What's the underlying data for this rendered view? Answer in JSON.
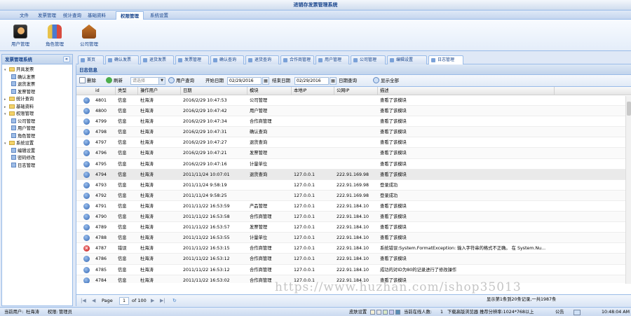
{
  "app": {
    "title": "进销存发票管理系统"
  },
  "menu": [
    "文件",
    "发票管理",
    "统计查询",
    "基础资料",
    "权限管理",
    "系统设置"
  ],
  "menu_active": 4,
  "ribbon": [
    "用户管理",
    "角色管理",
    "公司管理"
  ],
  "left_panel": {
    "title": "发票管理系统",
    "collapse": "«",
    "tree": [
      {
        "label": "开具发票",
        "type": "folder",
        "level": 0,
        "expanded": true
      },
      {
        "label": "确认发票",
        "type": "leaf",
        "level": 1
      },
      {
        "label": "退货发票",
        "type": "leaf",
        "level": 1
      },
      {
        "label": "发票管理",
        "type": "leaf",
        "level": 1
      },
      {
        "label": "统计查询",
        "type": "folder",
        "level": 0,
        "expanded": false
      },
      {
        "label": "基础资料",
        "type": "folder",
        "level": 0,
        "expanded": false
      },
      {
        "label": "权限管理",
        "type": "folder",
        "level": 0,
        "expanded": true
      },
      {
        "label": "公司管理",
        "type": "leaf",
        "level": 1
      },
      {
        "label": "用户管理",
        "type": "leaf",
        "level": 1
      },
      {
        "label": "角色管理",
        "type": "leaf",
        "level": 1
      },
      {
        "label": "系统设置",
        "type": "folder",
        "level": 0,
        "expanded": true
      },
      {
        "label": "编辑设置",
        "type": "leaf",
        "level": 1
      },
      {
        "label": "密码修改",
        "type": "leaf",
        "level": 1
      },
      {
        "label": "日志管理",
        "type": "leaf",
        "level": 1
      }
    ]
  },
  "tabs": [
    "首页",
    "确认发票",
    "退货发票",
    "发票管理",
    "确认查询",
    "退货查询",
    "合作商管理",
    "用户管理",
    "公司管理",
    "编辑设置",
    "日志管理"
  ],
  "tab_active": 10,
  "panel": {
    "title": "日志信息"
  },
  "toolbar": {
    "delete": "删除",
    "refresh": "刷新",
    "user_placeholder": "请选择",
    "user_query": "用户查询",
    "start_label": "开始日期",
    "start_date": "02/29/2016",
    "end_label": "结束日期",
    "end_date": "02/29/2016",
    "date_query": "日期查询",
    "show_all": "显示全部"
  },
  "grid": {
    "columns": [
      "id",
      "类型",
      "操作用户",
      "日期",
      "模块",
      "本地IP",
      "公网IP",
      "描述"
    ],
    "rows": [
      {
        "icon": "info",
        "id": "4801",
        "type": "信息",
        "user": "杜海涛",
        "date": "2016/2/29 10:47:53",
        "module": "公司管理",
        "local_ip": "",
        "public_ip": "",
        "desc": "查看了该模块"
      },
      {
        "icon": "info",
        "id": "4800",
        "type": "信息",
        "user": "杜海涛",
        "date": "2016/2/29 10:47:42",
        "module": "用户管理",
        "local_ip": "",
        "public_ip": "",
        "desc": "查看了该模块"
      },
      {
        "icon": "info",
        "id": "4799",
        "type": "信息",
        "user": "杜海涛",
        "date": "2016/2/29 10:47:34",
        "module": "合作商管理",
        "local_ip": "",
        "public_ip": "",
        "desc": "查看了该模块"
      },
      {
        "icon": "info",
        "id": "4798",
        "type": "信息",
        "user": "杜海涛",
        "date": "2016/2/29 10:47:31",
        "module": "确认查询",
        "local_ip": "",
        "public_ip": "",
        "desc": "查看了该模块"
      },
      {
        "icon": "info",
        "id": "4797",
        "type": "信息",
        "user": "杜海涛",
        "date": "2016/2/29 10:47:27",
        "module": "退货查询",
        "local_ip": "",
        "public_ip": "",
        "desc": "查看了该模块"
      },
      {
        "icon": "info",
        "id": "4796",
        "type": "信息",
        "user": "杜海涛",
        "date": "2016/2/29 10:47:21",
        "module": "发票管理",
        "local_ip": "",
        "public_ip": "",
        "desc": "查看了该模块"
      },
      {
        "icon": "info",
        "id": "4795",
        "type": "信息",
        "user": "杜海涛",
        "date": "2016/2/29 10:47:16",
        "module": "计量单位",
        "local_ip": "",
        "public_ip": "",
        "desc": "查看了该模块"
      },
      {
        "icon": "info",
        "id": "4794",
        "type": "信息",
        "user": "杜海涛",
        "date": "2011/11/24 10:07:01",
        "module": "退货查询",
        "local_ip": "127.0.0.1",
        "public_ip": "222.91.169.98",
        "desc": "查看了该模块",
        "highlight": true
      },
      {
        "icon": "info",
        "id": "4793",
        "type": "信息",
        "user": "杜海涛",
        "date": "2011/11/24 9:58:19",
        "module": "",
        "local_ip": "127.0.0.1",
        "public_ip": "222.91.169.98",
        "desc": "登录成功"
      },
      {
        "icon": "info",
        "id": "4792",
        "type": "信息",
        "user": "杜海涛",
        "date": "2011/11/24 9:58:25",
        "module": "",
        "local_ip": "127.0.0.1",
        "public_ip": "222.91.169.98",
        "desc": "登录成功"
      },
      {
        "icon": "info",
        "id": "4791",
        "type": "信息",
        "user": "杜海涛",
        "date": "2011/11/22 16:53:59",
        "module": "产品管理",
        "local_ip": "127.0.0.1",
        "public_ip": "222.91.184.10",
        "desc": "查看了该模块"
      },
      {
        "icon": "info",
        "id": "4790",
        "type": "信息",
        "user": "杜海涛",
        "date": "2011/11/22 16:53:58",
        "module": "合作商管理",
        "local_ip": "127.0.0.1",
        "public_ip": "222.91.184.10",
        "desc": "查看了该模块"
      },
      {
        "icon": "info",
        "id": "4789",
        "type": "信息",
        "user": "杜海涛",
        "date": "2011/11/22 16:53:57",
        "module": "发票管理",
        "local_ip": "127.0.0.1",
        "public_ip": "222.91.184.10",
        "desc": "查看了该模块"
      },
      {
        "icon": "info",
        "id": "4788",
        "type": "信息",
        "user": "杜海涛",
        "date": "2011/11/22 16:53:55",
        "module": "计量单位",
        "local_ip": "127.0.0.1",
        "public_ip": "222.91.184.10",
        "desc": "查看了该模块"
      },
      {
        "icon": "error",
        "id": "4787",
        "type": "错误",
        "user": "杜海涛",
        "date": "2011/11/22 16:53:15",
        "module": "合作商管理",
        "local_ip": "127.0.0.1",
        "public_ip": "222.91.184.10",
        "desc": "系统错误:System.FormatException: 输入字符串的格式不正确。 在 System.Nu..."
      },
      {
        "icon": "info",
        "id": "4786",
        "type": "信息",
        "user": "杜海涛",
        "date": "2011/11/22 16:53:12",
        "module": "合作商管理",
        "local_ip": "127.0.0.1",
        "public_ip": "222.91.184.10",
        "desc": "查看了该模块"
      },
      {
        "icon": "info",
        "id": "4785",
        "type": "信息",
        "user": "杜海涛",
        "date": "2011/11/22 16:53:12",
        "module": "合作商管理",
        "local_ip": "127.0.0.1",
        "public_ip": "222.91.184.10",
        "desc": "成功的对ID为80的记录进行了修改操作"
      },
      {
        "icon": "info",
        "id": "4784",
        "type": "信息",
        "user": "杜海涛",
        "date": "2011/11/22 16:53:02",
        "module": "合作商管理",
        "local_ip": "127.0.0.1",
        "public_ip": "222.91.184.10",
        "desc": "查看了该模块"
      },
      {
        "icon": "info",
        "id": "4783",
        "type": "信息",
        "user": "杜海涛",
        "date": "2011/11/22 16:52:58",
        "module": "计量单位",
        "local_ip": "127.0.0.1",
        "public_ip": "222.91.184.10",
        "desc": "查看了该模块"
      }
    ]
  },
  "pager": {
    "page_label": "Page",
    "page": "1",
    "of_label": "of 100",
    "summary": "显示第1条到20条记录,一共1987条"
  },
  "status": {
    "current_user_label": "当前用户:",
    "current_user": "杜海涛",
    "role_label": "权限:",
    "role": "管理员",
    "skin_label": "皮肤设置",
    "skin_colors": [
      "#f5efd6",
      "#e7e7e7",
      "#d7e7c7",
      "#c9c9ee",
      "#5a8fb6"
    ],
    "online_label": "当前在线人数:",
    "online": "1",
    "resolution_tip": "下载高版浏览器  推荐分辨率:1024*768以上",
    "notice": "公告",
    "time": "10:48:04 AM"
  },
  "watermark": "https://www.huzhan.com/ishop35013"
}
